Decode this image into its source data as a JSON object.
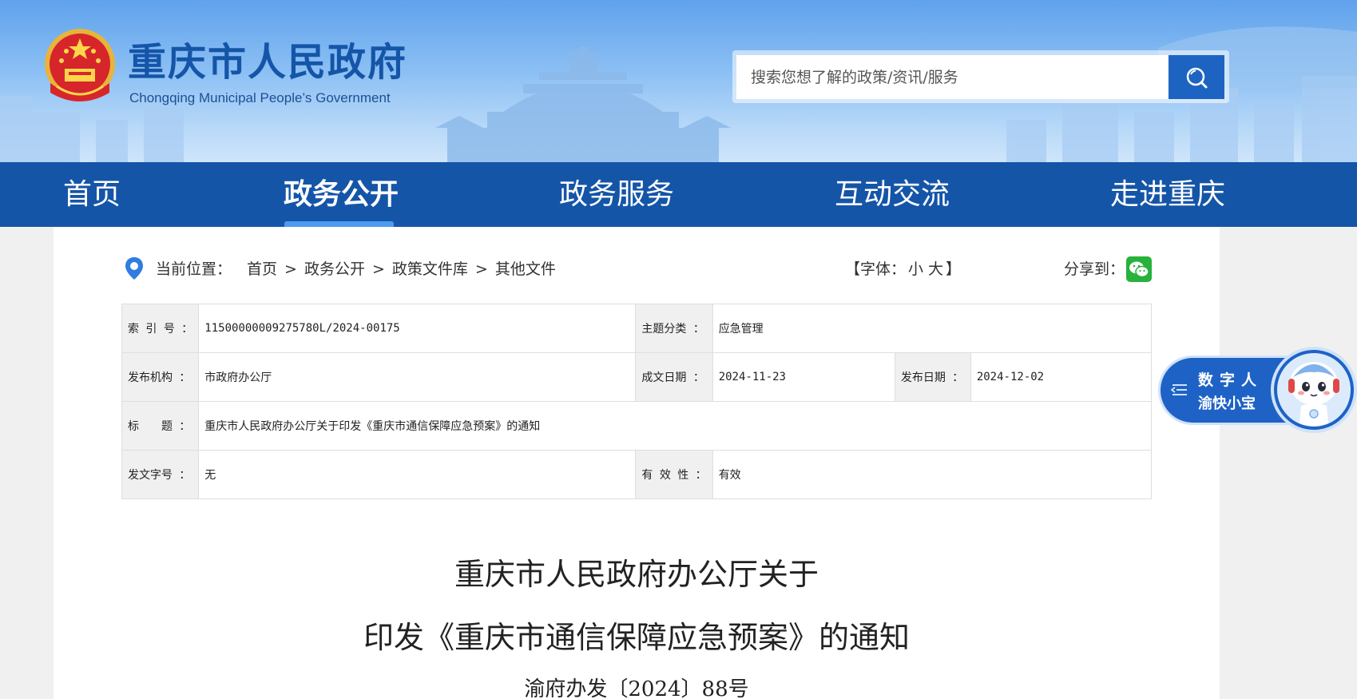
{
  "header": {
    "site_title": "重庆市人民政府",
    "site_subtitle": "Chongqing Municipal People’s Government",
    "search_placeholder": "搜索您想了解的政策/资讯/服务"
  },
  "nav": {
    "items": [
      {
        "label": "首页"
      },
      {
        "label": "政务公开"
      },
      {
        "label": "政务服务"
      },
      {
        "label": "互动交流"
      },
      {
        "label": "走进重庆"
      }
    ],
    "active_index": 1
  },
  "breadcrumb": {
    "prefix": "当前位置：",
    "items": [
      "首页",
      "政务公开",
      "政策文件库",
      "其他文件"
    ],
    "separator": ">"
  },
  "font_control": {
    "open": "【字体：",
    "small": "小",
    "large": "大",
    "close": "】"
  },
  "share": {
    "label": "分享到："
  },
  "meta": {
    "index_no_label": "索 引 号 ：",
    "index_no": "11500000009275780L/2024-00175",
    "topic_label": "主题分类 ：",
    "topic": "应急管理",
    "issuer_label": "发布机构 ：",
    "issuer": "市政府办公厅",
    "written_date_label": "成文日期 ：",
    "written_date": "2024-11-23",
    "publish_date_label": "发布日期 ：",
    "publish_date": "2024-12-02",
    "title_label": "标　　题 ：",
    "title": "重庆市人民政府办公厅关于印发《重庆市通信保障应急预案》的通知",
    "doc_no_label": "发文字号 ：",
    "doc_no": "无",
    "validity_label": "有 效 性 ：",
    "validity": "有效"
  },
  "article": {
    "title_line1": "重庆市人民政府办公厅关于",
    "title_line2": "印发《重庆市通信保障应急预案》的通知",
    "doc_number": "渝府办发〔2024〕88号"
  },
  "digital_human": {
    "line1": "数字人",
    "line2": "渝快小宝"
  },
  "colors": {
    "nav_bg": "#1555a8",
    "brand_blue": "#1d64c2",
    "nav_highlight": "#4d9af0",
    "wechat_green": "#27b23c",
    "location_pin": "#2f7de1"
  }
}
